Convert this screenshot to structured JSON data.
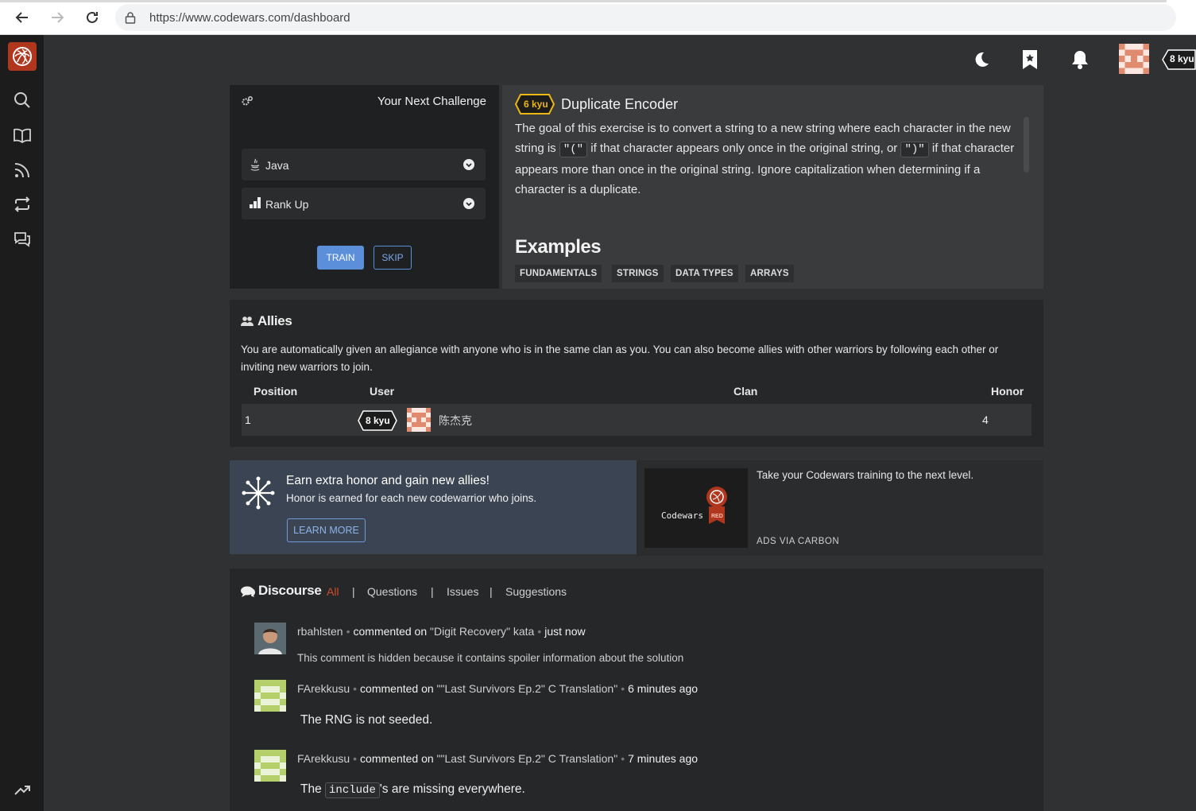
{
  "browser": {
    "url": "https://www.codewars.com/dashboard"
  },
  "header": {
    "rank": "8 kyu"
  },
  "challenge": {
    "title": "Your Next Challenge",
    "language": "Java",
    "strategy": "Rank Up",
    "train_label": "TRAIN",
    "skip_label": "SKIP"
  },
  "kata": {
    "rank": "6 kyu",
    "name": "Duplicate Encoder",
    "desc_1": "The goal of this exercise is to convert a string to a new string where each character in the new string is",
    "code_open": "\"(\"",
    "desc_2": "if that character appears only once in the original string, or",
    "code_close": "\")\"",
    "desc_3": "if that character appears more than once in the original string. Ignore capitalization when determining if a character is a duplicate.",
    "examples_heading": "Examples",
    "tags": [
      "FUNDAMENTALS",
      "STRINGS",
      "DATA TYPES",
      "ARRAYS"
    ]
  },
  "allies": {
    "title": "Allies",
    "description": "You are automatically given an allegiance with anyone who is in the same clan as you. You can also become allies with other warriors by following each other or inviting new warriors to join.",
    "columns": [
      "Position",
      "User",
      "Clan",
      "Honor"
    ],
    "rows": [
      {
        "position": "1",
        "rank": "8 kyu",
        "user": "陈杰克",
        "clan": "",
        "honor": "4"
      }
    ]
  },
  "promo": {
    "title": "Earn extra honor and gain new allies!",
    "subtitle": "Honor is earned for each new codewarrior who joins.",
    "button": "LEARN MORE"
  },
  "ad": {
    "brand": "Codewars",
    "badge": "RED",
    "text": "Take your Codewars training to the next level.",
    "via": "ADS VIA CARBON"
  },
  "discourse": {
    "title": "Discourse",
    "tabs": [
      "All",
      "Questions",
      "Issues",
      "Suggestions"
    ],
    "separator": "|",
    "comments": [
      {
        "user": "rbahlsten",
        "action": "commented on",
        "target": "\"Digit Recovery\" kata",
        "time": "just now",
        "body": "This comment is hidden because it contains spoiler information about the solution"
      },
      {
        "user": "FArekkusu",
        "action": "commented on",
        "target": "\"\"Last Survivors Ep.2\" C Translation\"",
        "time": "6 minutes ago",
        "body": "The RNG is not seeded."
      },
      {
        "user": "FArekkusu",
        "action": "commented on",
        "target": "\"\"Last Survivors Ep.2\" C Translation\"",
        "time": "7 minutes ago",
        "body_pre": "The",
        "body_code": "include",
        "body_post": "'s are missing everywhere."
      }
    ]
  },
  "colors": {
    "accent_red": "#b1361e",
    "train_blue": "#5b8fd9",
    "kyu6_yellow": "#ecb613",
    "active_tab": "#d24b2b"
  }
}
